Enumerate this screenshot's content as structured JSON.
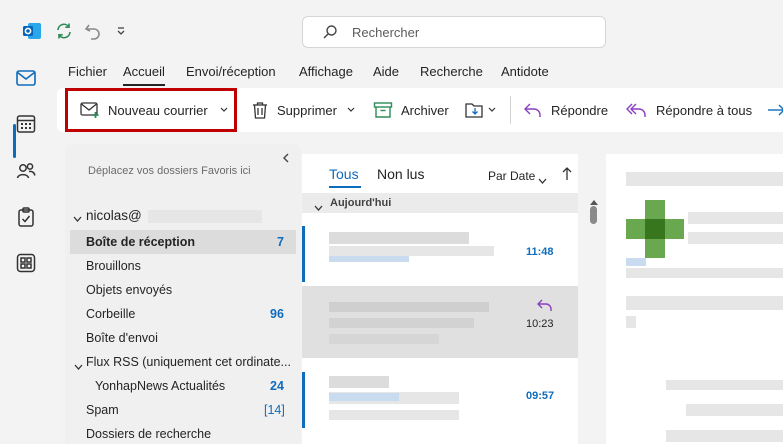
{
  "search": {
    "placeholder": "Rechercher"
  },
  "menu": {
    "tabs": [
      "Fichier",
      "Accueil",
      "Envoi/réception",
      "Affichage",
      "Aide",
      "Recherche",
      "Antidote"
    ],
    "active": "Accueil"
  },
  "ribbon": {
    "new_mail": "Nouveau courrier",
    "delete": "Supprimer",
    "archive": "Archiver",
    "reply": "Répondre",
    "reply_all": "Répondre à tous"
  },
  "folders": {
    "favorites_hint": "Déplacez vos dossiers Favoris ici",
    "account": "nicolas@",
    "items": [
      {
        "label": "Boîte de réception",
        "count": "7"
      },
      {
        "label": "Brouillons",
        "count": ""
      },
      {
        "label": "Objets envoyés",
        "count": ""
      },
      {
        "label": "Corbeille",
        "count": "96"
      },
      {
        "label": "Boîte d'envoi",
        "count": ""
      },
      {
        "label": "Flux RSS (uniquement cet ordinate...",
        "count": ""
      },
      {
        "label": "YonhapNews Actualités",
        "count": "24"
      },
      {
        "label": "Spam",
        "count": "[14]"
      },
      {
        "label": "Dossiers de recherche",
        "count": ""
      }
    ]
  },
  "messages": {
    "tab_all": "Tous",
    "tab_unread": "Non lus",
    "sort": "Par Date",
    "group": "Aujourd'hui",
    "items": [
      {
        "time": "11:48"
      },
      {
        "time": "10:23"
      },
      {
        "time": "09:57"
      }
    ]
  },
  "colors": {
    "accent": "#0f6cbd",
    "highlight": "#c00000"
  }
}
